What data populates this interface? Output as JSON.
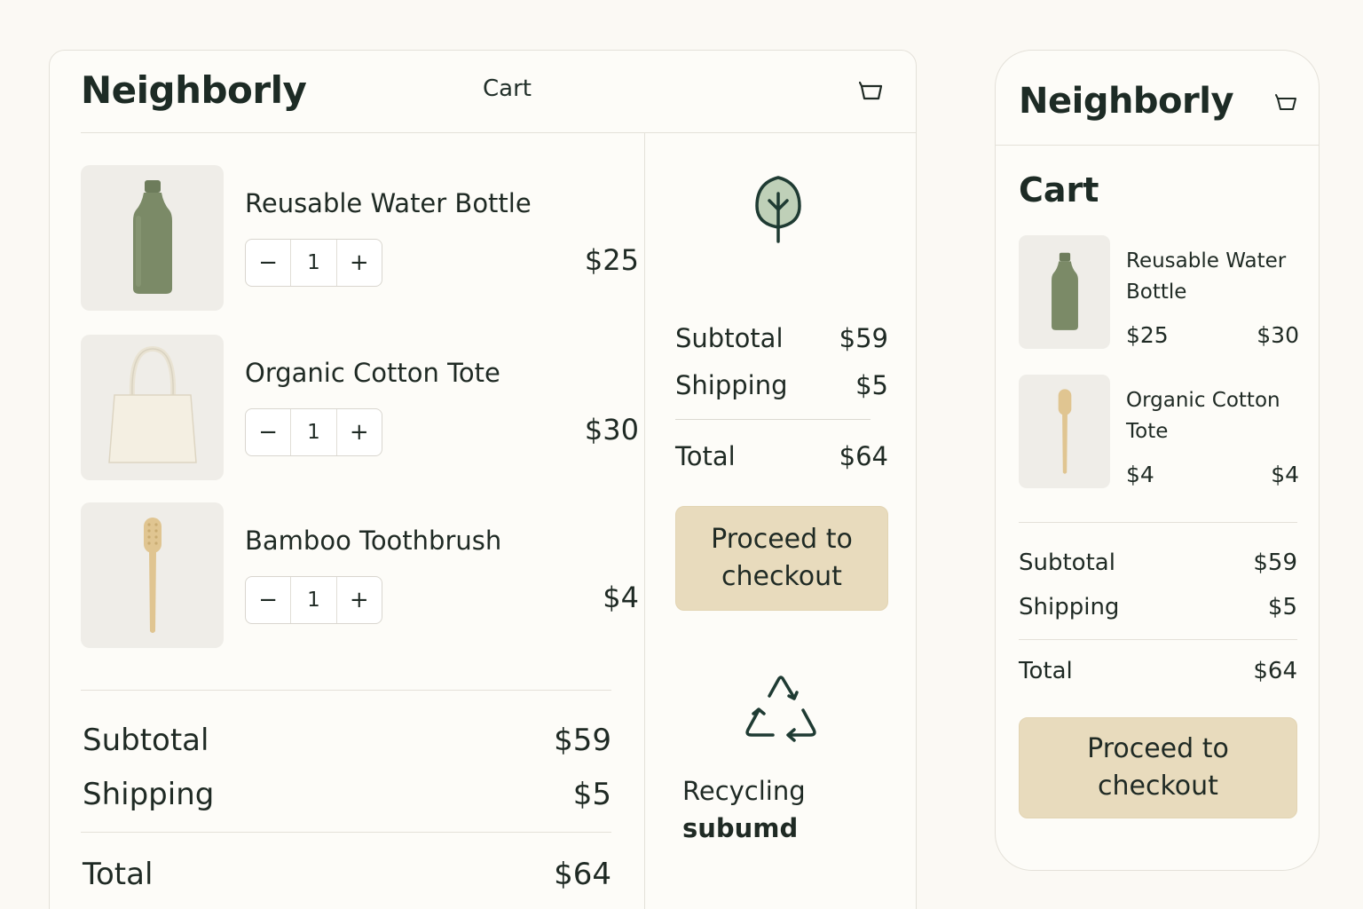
{
  "brand": "Neighborly",
  "colors": {
    "accent_button": "#e8dbbd",
    "text_dark": "#1f2a24",
    "bottle_green": "#7b8a67",
    "bamboo": "#e0c591"
  },
  "desktop": {
    "nav_cart_label": "Cart",
    "bag_icon": "shopping-bag-icon",
    "items": [
      {
        "name": "Reusable Water Bottle",
        "qty": "1",
        "price": "$25",
        "image": "water-bottle"
      },
      {
        "name": "Organic Cotton Tote",
        "qty": "1",
        "price": "$30",
        "image": "cotton-tote"
      },
      {
        "name": "Bamboo Toothbrush",
        "qty": "1",
        "price": "$4",
        "image": "bamboo-toothbrush"
      }
    ],
    "stepper": {
      "minus": "−",
      "plus": "+"
    },
    "summary": {
      "subtotal_label": "Subtotal",
      "subtotal_value": "$59",
      "shipping_label": "Shipping",
      "shipping_value": "$5",
      "total_label": "Total",
      "total_value": "$64"
    },
    "sidebar": {
      "leaf_icon": "leaf-icon",
      "subtotal_label": "Subtotal",
      "subtotal_value": "$59",
      "shipping_label": "Shipping",
      "shipping_value": "$5",
      "total_label": "Total",
      "total_value": "$64",
      "checkout_line1": "Proceed to",
      "checkout_line2": "checkout",
      "recycle_icon": "recycle-icon",
      "recycle_line1": "Recycling",
      "recycle_line2": "subumd"
    }
  },
  "mobile": {
    "title": "Cart",
    "items": [
      {
        "name": "Reusable Water Bottle",
        "price_a": "$25",
        "price_b": "$30",
        "image": "water-bottle"
      },
      {
        "name": "Organic Cotton Tote",
        "price_a": "$4",
        "price_b": "$4",
        "image": "bamboo-toothbrush"
      }
    ],
    "summary": {
      "subtotal_label": "Subtotal",
      "subtotal_value": "$59",
      "shipping_label": "Shipping",
      "shipping_value": "$5",
      "total_label": "Total",
      "total_value": "$64"
    },
    "checkout_line1": "Proceed to",
    "checkout_line2": "checkout"
  }
}
